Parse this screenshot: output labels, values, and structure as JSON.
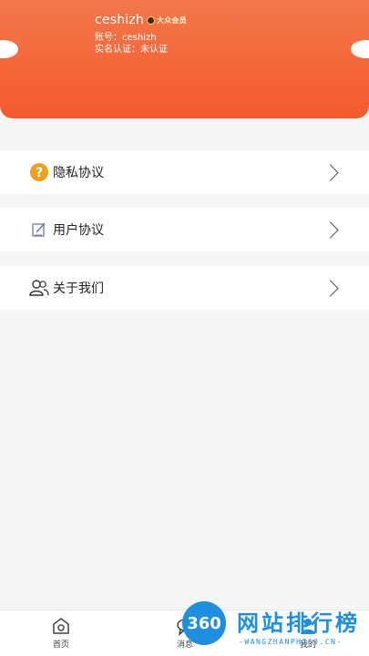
{
  "profile": {
    "username": "ceshizh",
    "vip_label": "大众会员",
    "account_line": "账号：ceshizh",
    "realname_line": "实名认证：未认证"
  },
  "menu": {
    "items": [
      {
        "label": "隐私协议",
        "icon": "question-icon"
      },
      {
        "label": "用户协议",
        "icon": "edit-icon"
      },
      {
        "label": "关于我们",
        "icon": "users-icon"
      }
    ]
  },
  "tabbar": {
    "items": [
      {
        "label": "首页",
        "icon": "home-icon"
      },
      {
        "label": "消息",
        "icon": "message-icon"
      },
      {
        "label": "我的",
        "icon": "user-icon"
      }
    ]
  },
  "watermark": {
    "logo_text": "360",
    "title": "网站排行榜",
    "subtitle": "-WANGZHANPH360.CN-"
  },
  "colors": {
    "header_accent": "#f45a2e",
    "question_icon": "#f0a020",
    "watermark_blue": "#1e8fe0"
  }
}
